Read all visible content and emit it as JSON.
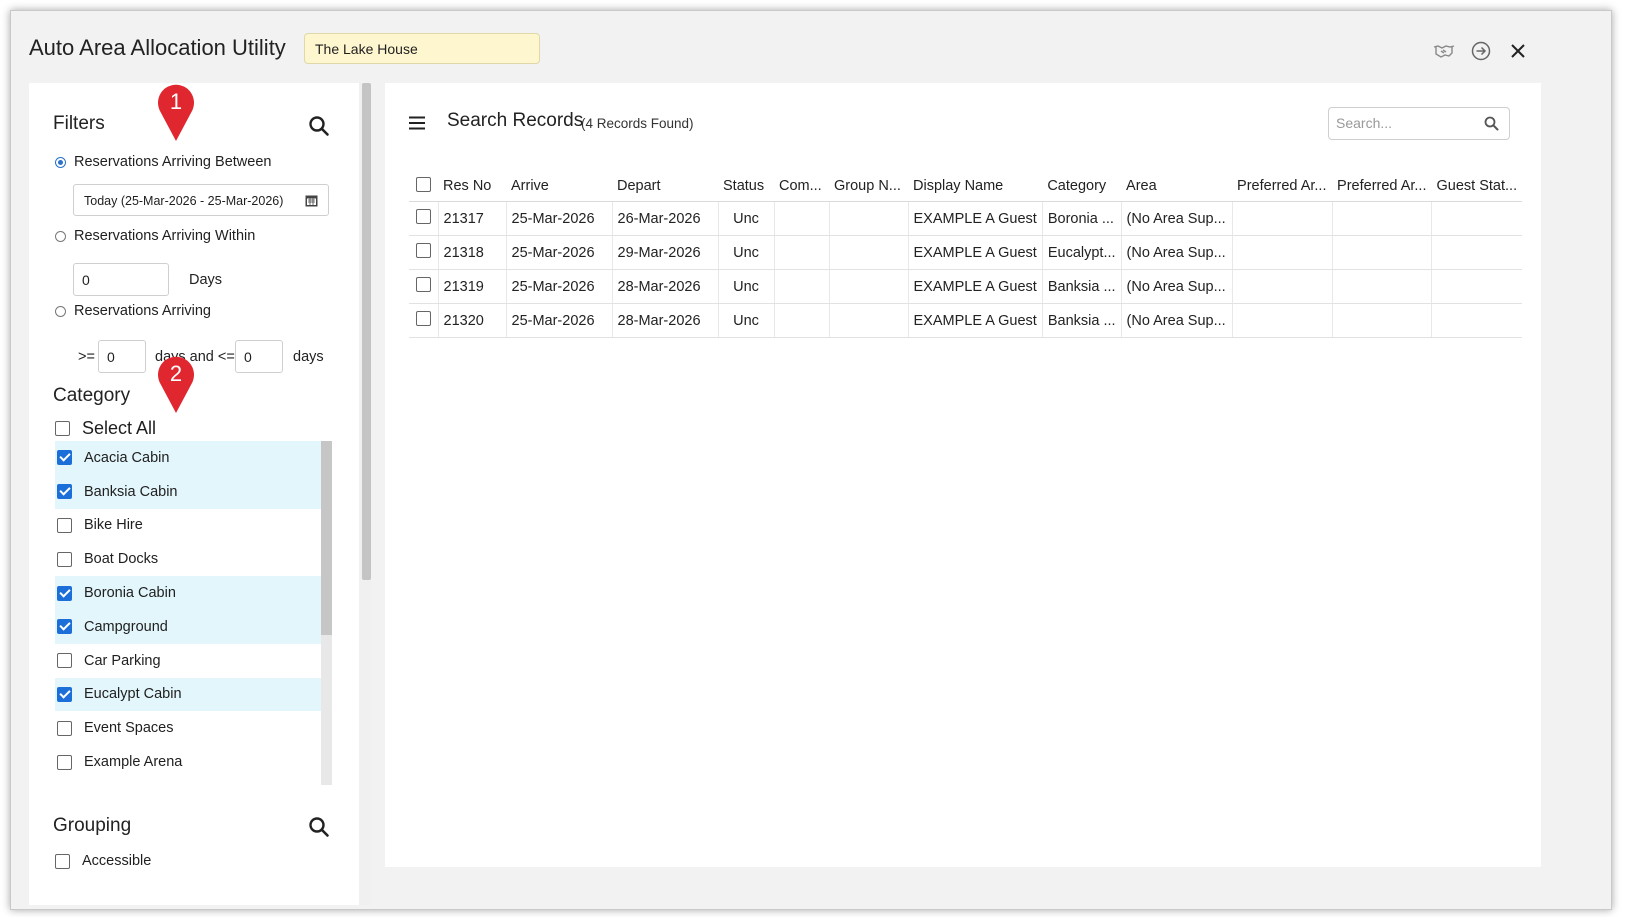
{
  "window": {
    "title": "Auto Area Allocation Utility",
    "property": "The Lake House",
    "icons": [
      "handshake-icon",
      "arrow-circle-right-icon",
      "close-icon"
    ]
  },
  "filters": {
    "heading": "Filters",
    "radio_between": "Reservations Arriving Between",
    "date_range": "Today (25-Mar-2026 - 25-Mar-2026)",
    "radio_within": "Reservations Arriving Within",
    "within_value": "0",
    "within_unit": "Days",
    "radio_arriving": "Reservations Arriving",
    "gte_label": ">=",
    "gte_value": "0",
    "days_and_lte": "days and <=",
    "lte_value": "0",
    "days_label": "days",
    "selected_option": "Reservations Arriving Between"
  },
  "markers": [
    "1",
    "2"
  ],
  "category": {
    "heading": "Category",
    "select_all": "Select All",
    "items": [
      {
        "label": "Acacia Cabin",
        "checked": true
      },
      {
        "label": "Banksia Cabin",
        "checked": true
      },
      {
        "label": "Bike Hire",
        "checked": false
      },
      {
        "label": "Boat Docks",
        "checked": false
      },
      {
        "label": "Boronia Cabin",
        "checked": true
      },
      {
        "label": "Campground",
        "checked": true
      },
      {
        "label": "Car Parking",
        "checked": false
      },
      {
        "label": "Eucalypt Cabin",
        "checked": true
      },
      {
        "label": "Event Spaces",
        "checked": false
      },
      {
        "label": "Example Arena",
        "checked": false
      }
    ]
  },
  "grouping": {
    "heading": "Grouping",
    "items": [
      {
        "label": "Accessible",
        "checked": false
      }
    ]
  },
  "results": {
    "title": "Search Records",
    "count": "(4 Records Found)",
    "search_placeholder": "Search...",
    "columns": [
      "Res No",
      "Arrive",
      "Depart",
      "Status",
      "Com...",
      "Group N...",
      "Display Name",
      "Category",
      "Area",
      "Preferred Ar...",
      "Preferred Ar...",
      "Guest Stat..."
    ],
    "rows": [
      {
        "res_no": "21317",
        "arrive": "25-Mar-2026",
        "depart": "26-Mar-2026",
        "status": "Unc",
        "com": "",
        "group": "",
        "display_name": "EXAMPLE A Guest",
        "category": "Boronia ...",
        "area": "(No Area Sup...",
        "pref1": "",
        "pref2": "",
        "guest_status": ""
      },
      {
        "res_no": "21318",
        "arrive": "25-Mar-2026",
        "depart": "29-Mar-2026",
        "status": "Unc",
        "com": "",
        "group": "",
        "display_name": "EXAMPLE A Guest",
        "category": "Eucalypt...",
        "area": "(No Area Sup...",
        "pref1": "",
        "pref2": "",
        "guest_status": ""
      },
      {
        "res_no": "21319",
        "arrive": "25-Mar-2026",
        "depart": "28-Mar-2026",
        "status": "Unc",
        "com": "",
        "group": "",
        "display_name": "EXAMPLE A Guest",
        "category": "Banksia ...",
        "area": "(No Area Sup...",
        "pref1": "",
        "pref2": "",
        "guest_status": ""
      },
      {
        "res_no": "21320",
        "arrive": "25-Mar-2026",
        "depart": "28-Mar-2026",
        "status": "Unc",
        "com": "",
        "group": "",
        "display_name": "EXAMPLE A Guest",
        "category": "Banksia ...",
        "area": "(No Area Sup...",
        "pref1": "",
        "pref2": "",
        "guest_status": ""
      }
    ]
  }
}
